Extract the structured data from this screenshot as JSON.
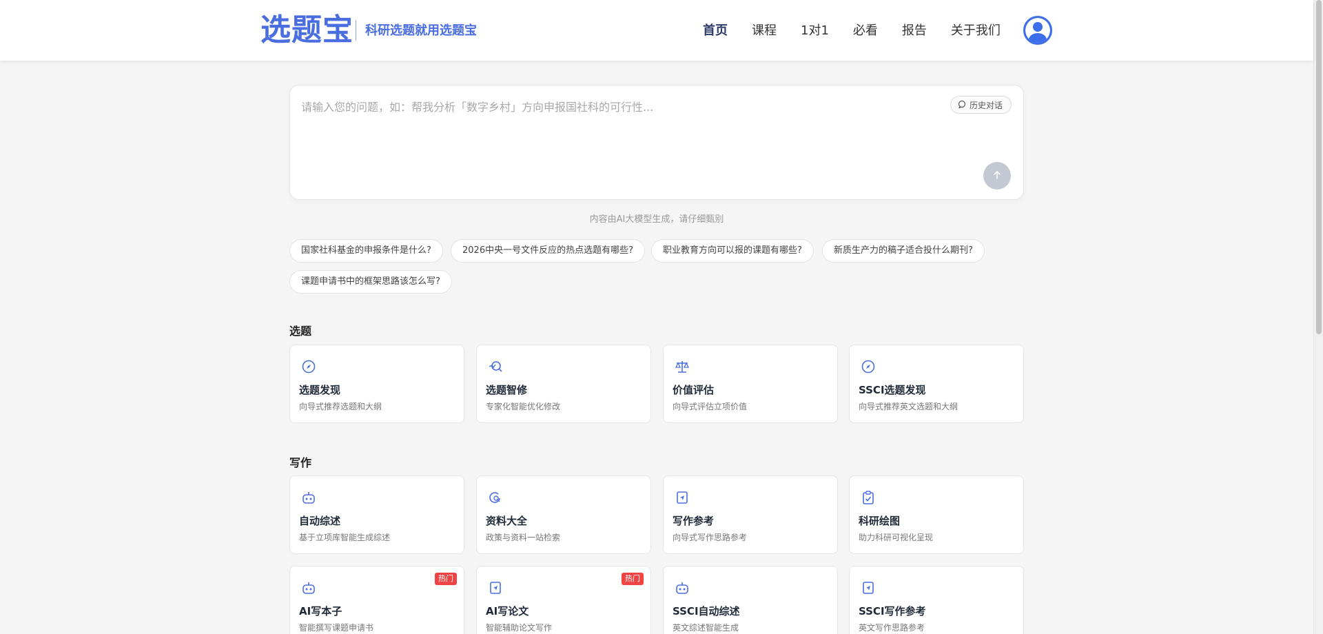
{
  "header": {
    "logo": "选题宝",
    "slogan": "科研选题就用选题宝",
    "nav": [
      "首页",
      "课程",
      "1对1",
      "必看",
      "报告",
      "关于我们"
    ],
    "active_nav": "首页"
  },
  "chat": {
    "placeholder": "请输入您的问题，如：帮我分析「数字乡村」方向申报国社科的可行性...",
    "history_label": "历史对话",
    "send_icon": "arrow-up-icon",
    "disclaimer": "内容由AI大模型生成，请仔细甄别"
  },
  "suggestions": [
    "国家社科基金的申报条件是什么?",
    "2026中央一号文件反应的热点选题有哪些?",
    "职业教育方向可以报的课题有哪些?",
    "新质生产力的稿子适合投什么期刊?",
    "课题申请书中的框架思路该怎么写?"
  ],
  "sections": [
    {
      "title": "选题",
      "cards": [
        {
          "title": "选题发现",
          "desc": "向导式推荐选题和大纲",
          "icon": "compass-icon"
        },
        {
          "title": "选题智修",
          "desc": "专家化智能优化修改",
          "icon": "magic-search-icon"
        },
        {
          "title": "价值评估",
          "desc": "向导式评估立项价值",
          "icon": "scale-icon"
        },
        {
          "title": "SSCI选题发现",
          "desc": "向导式推荐英文选题和大纲",
          "icon": "compass-icon"
        }
      ]
    },
    {
      "title": "写作",
      "cards": [
        {
          "title": "自动综述",
          "desc": "基于立项库智能生成综述",
          "icon": "robot-icon"
        },
        {
          "title": "资料大全",
          "desc": "政策与资料一站检索",
          "icon": "data-search-icon"
        },
        {
          "title": "写作参考",
          "desc": "向导式写作思路参考",
          "icon": "send-doc-icon"
        },
        {
          "title": "科研绘图",
          "desc": "助力科研可视化呈现",
          "icon": "clipboard-check-icon"
        },
        {
          "title": "AI写本子",
          "desc": "智能撰写课题申请书",
          "icon": "robot-icon",
          "badge": "热门"
        },
        {
          "title": "AI写论文",
          "desc": "智能辅助论文写作",
          "icon": "send-doc-icon",
          "badge": "热门"
        },
        {
          "title": "SSCI自动综述",
          "desc": "英文综述智能生成",
          "icon": "robot-icon"
        },
        {
          "title": "SSCI写作参考",
          "desc": "英文写作思路参考",
          "icon": "send-doc-icon"
        }
      ]
    }
  ],
  "colors": {
    "brand": "#4a6ee0",
    "hot_badge": "#ef4444",
    "icon": "#4a6ee0"
  }
}
